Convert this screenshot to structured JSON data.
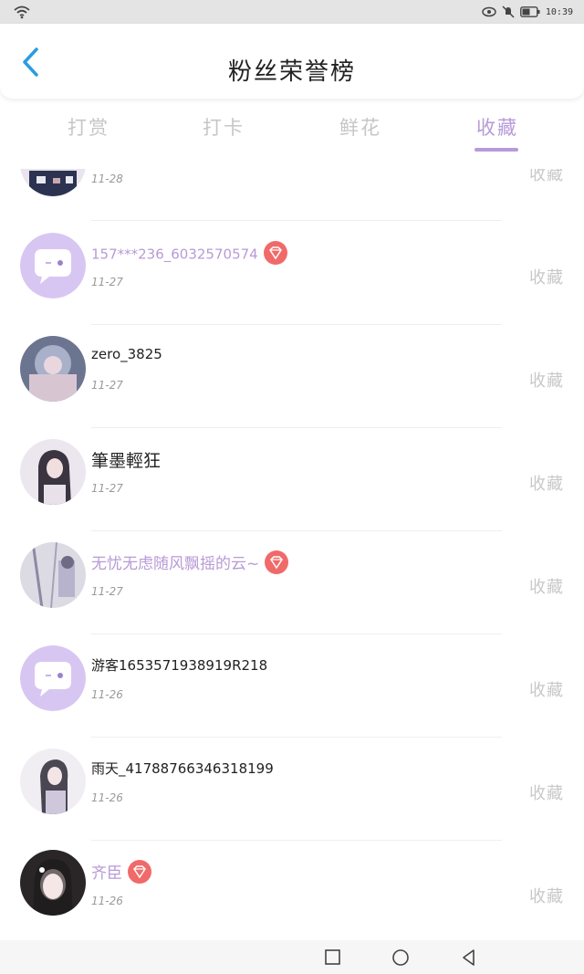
{
  "status_bar": {
    "time": "10:39"
  },
  "header": {
    "title": "粉丝荣誉榜"
  },
  "tabs": [
    {
      "label": "打赏",
      "active": false
    },
    {
      "label": "打卡",
      "active": false
    },
    {
      "label": "鲜花",
      "active": false
    },
    {
      "label": "收藏",
      "active": true
    }
  ],
  "colors": {
    "accent": "#b79ad8",
    "vip_badge": "#f06a6a",
    "inactive_tab": "#c6c6c6"
  },
  "list": [
    {
      "name": "",
      "date": "11-28",
      "action": "收藏",
      "vip": false,
      "avatar": "photo"
    },
    {
      "name": "157***236_6032570574",
      "date": "11-27",
      "action": "收藏",
      "vip": true,
      "avatar": "default-chat-avatar"
    },
    {
      "name": "zero_3825",
      "date": "11-27",
      "action": "收藏",
      "vip": false,
      "avatar": "photo"
    },
    {
      "name": "筆墨輕狂",
      "date": "11-27",
      "action": "收藏",
      "vip": false,
      "avatar": "photo"
    },
    {
      "name": "无忧无虑随风飘摇的云~",
      "date": "11-27",
      "action": "收藏",
      "vip": true,
      "avatar": "photo"
    },
    {
      "name": "游客1653571938919R218",
      "date": "11-26",
      "action": "收藏",
      "vip": false,
      "avatar": "default-chat-avatar"
    },
    {
      "name": "雨天_41788766346318199",
      "date": "11-26",
      "action": "收藏",
      "vip": false,
      "avatar": "photo"
    },
    {
      "name": "齐臣",
      "date": "11-26",
      "action": "收藏",
      "vip": true,
      "avatar": "photo"
    }
  ]
}
